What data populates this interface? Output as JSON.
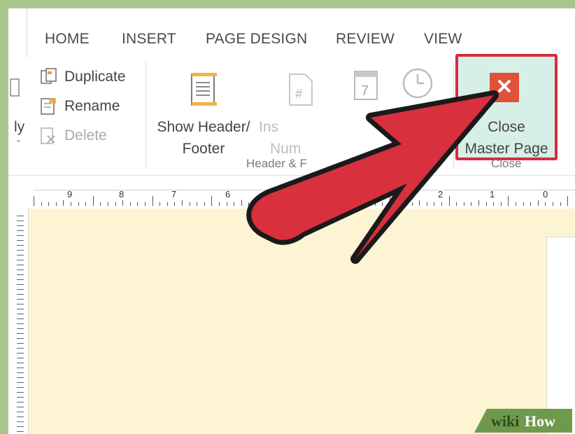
{
  "tabs": [
    "HOME",
    "INSERT",
    "PAGE DESIGN",
    "REVIEW",
    "VIEW"
  ],
  "ribbon": {
    "left_fragment_1": "ly",
    "left_fragment_2": "-",
    "duplicate_label": "Duplicate",
    "rename_label": "Rename",
    "delete_label": "Delete",
    "show_header_footer": {
      "line1": "Show Header/",
      "line2": "Footer"
    },
    "insert_page_number": {
      "line1": "Ins",
      "line2": "Num"
    },
    "page_number_icon_glyph": "#",
    "date_icon_digit": "7",
    "header_footer_group": "Header & F",
    "close_master_page": {
      "line1": "Close",
      "line2": "Master Page"
    },
    "close_group": "Close",
    "close_icon_glyph": "✕"
  },
  "ruler_numbers": [
    "9",
    "8",
    "7",
    "6",
    "2",
    "1",
    "0"
  ],
  "watermark": {
    "wiki": "wiki",
    "how": "How"
  },
  "colors": {
    "frame_green": "#a9c58c",
    "close_highlight_border": "#d72c3c",
    "close_highlight_fill": "#d6efe9",
    "close_icon_bg": "#e0513a",
    "arrow_red": "#d9303e",
    "canvas": "#fdf4d4"
  }
}
